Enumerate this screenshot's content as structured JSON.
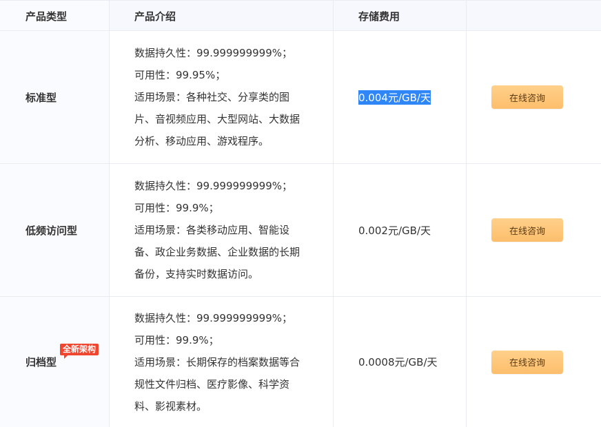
{
  "header": {
    "col_type": "产品类型",
    "col_intro": "产品介绍",
    "col_price": "存储费用",
    "col_action": ""
  },
  "rows": [
    {
      "type": "标准型",
      "desc": [
        "数据持久性：99.999999999%；",
        "可用性：99.95%；",
        "适用场景：各种社交、分享类的图片、音视频应用、大型网站、大数据分析、移动应用、游戏程序。"
      ],
      "price": "0.004元/GB/天",
      "button": "在线咨询"
    },
    {
      "type": "低频访问型",
      "desc": [
        "数据持久性：99.999999999%；",
        "可用性：99.9%；",
        "适用场景：各类移动应用、智能设备、政企业务数据、企业数据的长期备份，支持实时数据访问。"
      ],
      "price": "0.002元/GB/天",
      "button": "在线咨询"
    },
    {
      "type": "归档型",
      "badge": "全新架构",
      "desc": [
        "数据持久性：99.999999999%；",
        "可用性：99.9%；",
        "适用场景：长期保存的档案数据等合规性文件归档、医疗影像、科学资料、影视素材。"
      ],
      "price": "0.0008元/GB/天",
      "button": "在线咨询"
    }
  ],
  "colors": {
    "header_bg": "#f6f8fd",
    "border": "#e8ebf2",
    "selection": "#2f86f6",
    "button_gradient_top": "#ffd08a",
    "button_gradient_bottom": "#fdbe6c",
    "badge": "#f0452f"
  }
}
